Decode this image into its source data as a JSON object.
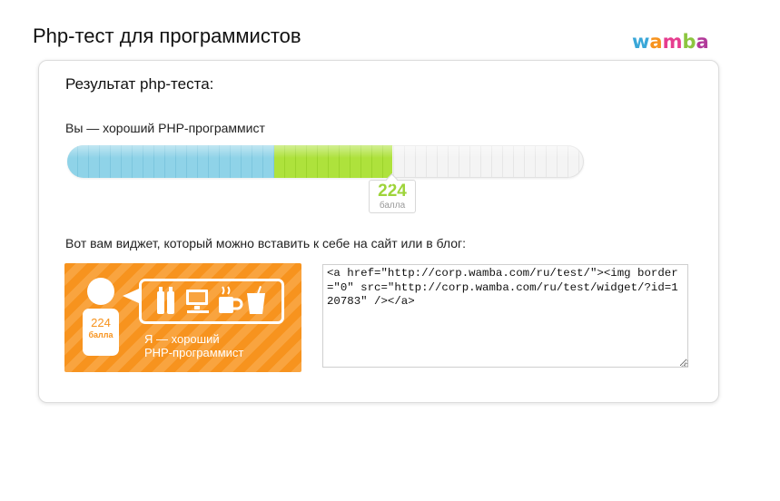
{
  "page": {
    "title": "Php-тест для программистов",
    "logo": {
      "letters": [
        "w",
        "a",
        "m",
        "b",
        "a"
      ],
      "colors": [
        "#3aa7d8",
        "#f7931e",
        "#e63d8f",
        "#8cc63f",
        "#b23a9a"
      ]
    }
  },
  "result": {
    "heading": "Результат php-теста:",
    "verdict": "Вы — хороший PHP-программист",
    "progress": {
      "blue_fraction": 0.4,
      "green_fraction": 0.23,
      "colors": {
        "blue": "#8fd3e8",
        "green": "#aee23c",
        "empty": "#f4f4f4"
      }
    },
    "score": {
      "value": "224",
      "unit": "балла",
      "color": "#9ed43a"
    }
  },
  "widget": {
    "caption": "Вот вам виджет, который можно вставить к себе на сайт или в блог:",
    "badge": {
      "score": "224",
      "unit": "балла",
      "line1": "Я — хороший",
      "line2": "PHP-программист",
      "icons": [
        "bottles-icon",
        "computer-icon",
        "coffee-cup-icon",
        "drink-glass-icon"
      ],
      "color": "#f7931e"
    },
    "code": "<a href=\"http://corp.wamba.com/ru/test/\"><img border=\"0\" src=\"http://corp.wamba.com/ru/test/widget/?id=120783\" /></a>"
  }
}
